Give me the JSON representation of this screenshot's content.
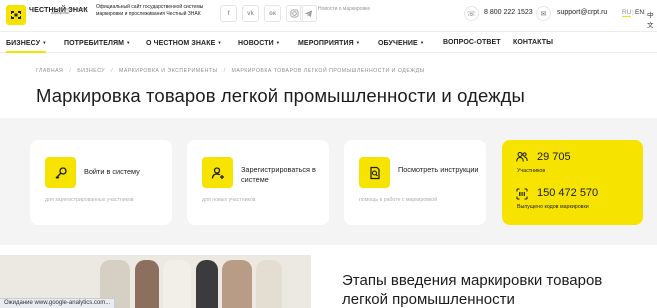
{
  "header": {
    "logo_word": "ЧЕСТНЫЙ ЗНАК",
    "logo_tagline": "национальная система маркировки",
    "site_description": "Официальный сайт государственной системы маркировки и прослеживания Честный ЗНАК",
    "social_icons": [
      "f",
      "vk",
      "ok",
      "instagram",
      "telegram"
    ],
    "subscribe_text": "Новости о маркировке",
    "phone": "8 800 222 1523",
    "email": "support@crpt.ru",
    "languages": [
      "RU",
      "EN",
      "中文"
    ],
    "active_language": "RU"
  },
  "nav": {
    "items": [
      {
        "label": "БИЗНЕСУ",
        "caret": "▾"
      },
      {
        "label": "ПОТРЕБИТЕЛЯМ",
        "caret": "▾"
      },
      {
        "label": "О ЧЕСТНОМ ЗНАКЕ",
        "caret": "▾"
      },
      {
        "label": "НОВОСТИ",
        "caret": "▾"
      },
      {
        "label": "МЕРОПРИЯТИЯ",
        "caret": "▾"
      },
      {
        "label": "ОБУЧЕНИЕ",
        "caret": "▾"
      },
      {
        "label": "ВОПРОС-ОТВЕТ",
        "caret": ""
      },
      {
        "label": "КОНТАКТЫ",
        "caret": ""
      }
    ],
    "active_index": 0
  },
  "breadcrumbs": [
    "ГЛАВНАЯ",
    "БИЗНЕСУ",
    "МАРКИРОВКА И ЭКСПЕРИМЕНТЫ",
    "МАРКИРОВКА ТОВАРОВ ЛЕГКОЙ ПРОМЫШЛЕННОСТИ И ОДЕЖДЫ"
  ],
  "breadcrumb_separator": "/",
  "page_title": "Маркировка товаров легкой промышленности и одежды",
  "cards": [
    {
      "icon": "key-icon",
      "title": "Войти в систему",
      "subtitle": "для зарегистрированных участников"
    },
    {
      "icon": "add-user-icon",
      "title": "Зарегистрироваться в системе",
      "subtitle": "для новых участников"
    },
    {
      "icon": "document-search-icon",
      "title": "Посмотреть инструкции",
      "subtitle": "помощь в работе с маркировкой"
    }
  ],
  "stats": [
    {
      "icon": "users-icon",
      "value": "29 705",
      "label": "Участников"
    },
    {
      "icon": "barcode-icon",
      "value": "150 472 570",
      "label": "Выпущено кодов маркировки"
    }
  ],
  "section_title": "Этапы введения маркировки товаров легкой промышленности",
  "status_bar": "Ожидание www.google-analytics.com...",
  "colors": {
    "accent": "#f6e400",
    "band_background": "#f4f4f4",
    "text": "#1c1c1c",
    "muted": "#b0b0b0"
  }
}
